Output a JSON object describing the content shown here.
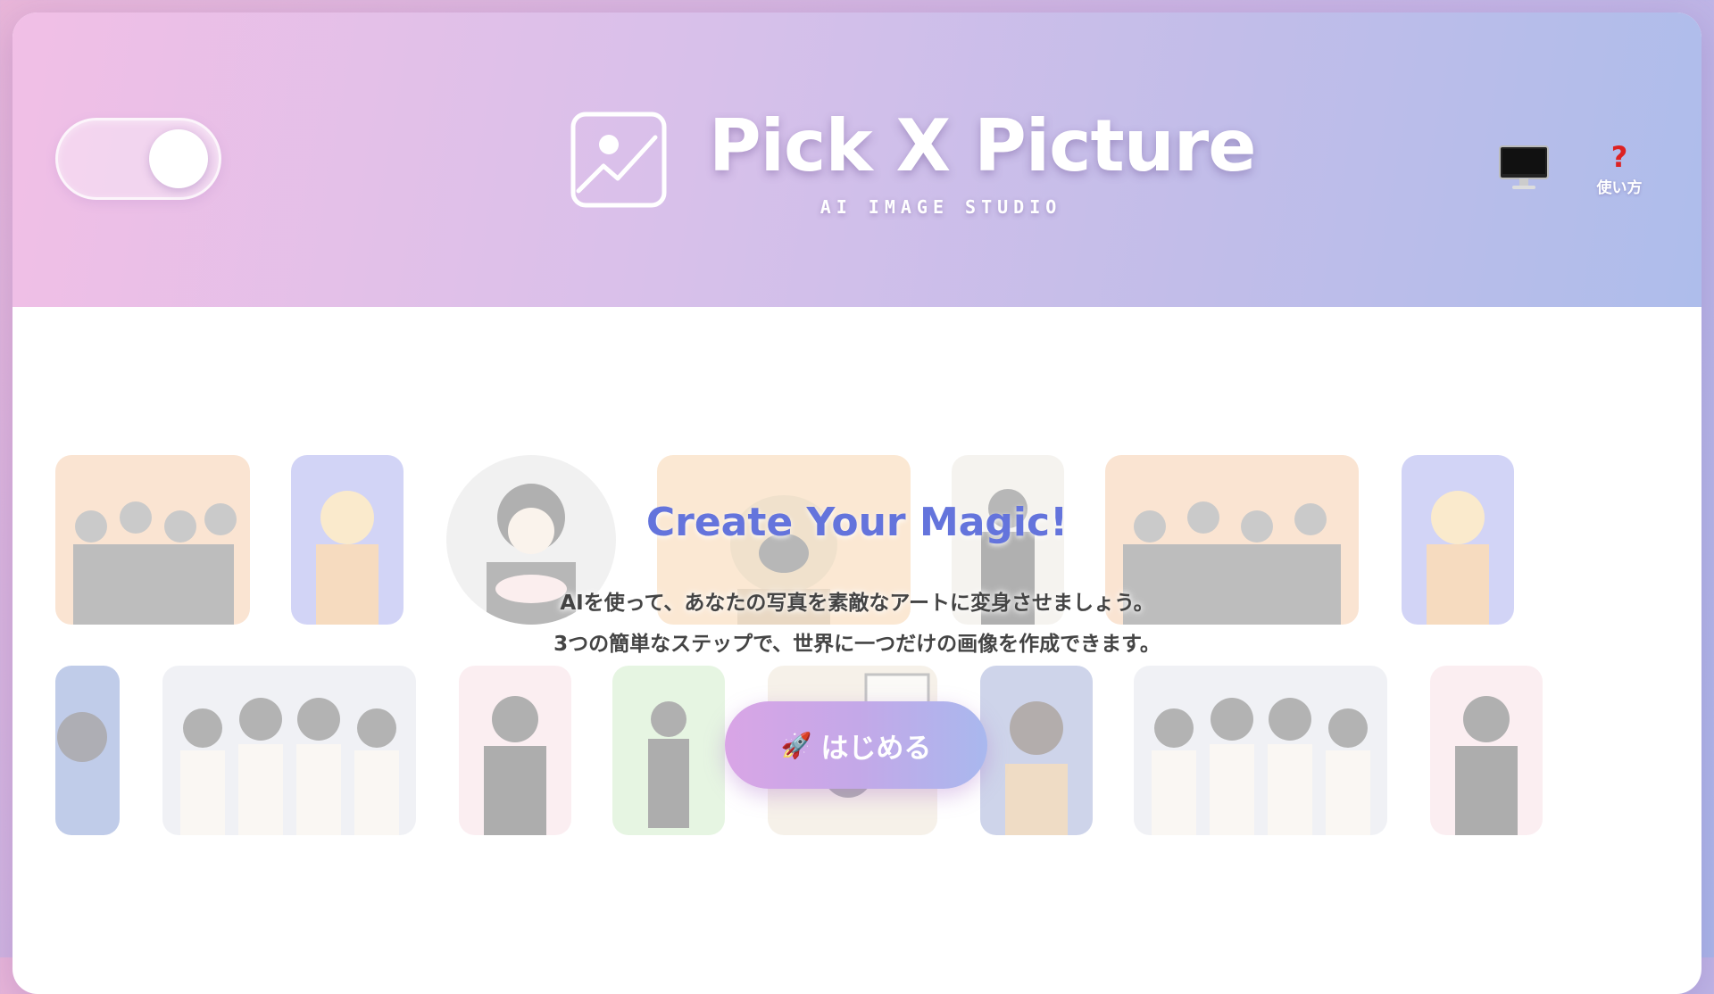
{
  "header": {
    "title": "Pick X Picture",
    "subtitle": "AI IMAGE STUDIO",
    "help_mark": "?",
    "help_label": "使い方"
  },
  "icons": {
    "logo": "image-icon",
    "monitor": "monitor-icon",
    "help": "question-icon",
    "rocket": "rocket-icon"
  },
  "toggle": {
    "state": "on"
  },
  "hero": {
    "title": "Create Your Magic!",
    "line1": "AIを使って、あなたの写真を素敵なアートに変身させましょう。",
    "line2": "3つの簡単なステップで、世界に一つだけの画像を作成できます。",
    "start_icon": "🚀",
    "start_label": "はじめる"
  },
  "colors": {
    "accent_title": "#6474dc",
    "header_gradient_start": "#f1bfe6",
    "header_gradient_end": "#aebdeb",
    "help_red": "#dd2222"
  }
}
